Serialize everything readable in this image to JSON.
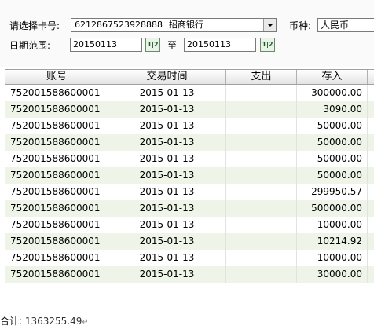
{
  "filters": {
    "card_label": "请选择卡号:",
    "card_number": "6212867523928888",
    "bank_name": "招商银行",
    "currency_label": "币种:",
    "currency_value": "人民币",
    "date_label": "日期范围:",
    "date_from": "20150113",
    "date_to": "20150113",
    "to_label": "至",
    "calendar_button": "1|2"
  },
  "table": {
    "columns": [
      "账号",
      "交易时间",
      "支出",
      "存入"
    ],
    "rows": [
      [
        "752001588600001",
        "2015-01-13",
        "",
        "300000.00"
      ],
      [
        "752001588600001",
        "2015-01-13",
        "",
        "3090.00"
      ],
      [
        "752001588600001",
        "2015-01-13",
        "",
        "50000.00"
      ],
      [
        "752001588600001",
        "2015-01-13",
        "",
        "50000.00"
      ],
      [
        "752001588600001",
        "2015-01-13",
        "",
        "50000.00"
      ],
      [
        "752001588600001",
        "2015-01-13",
        "",
        "50000.00"
      ],
      [
        "752001588600001",
        "2015-01-13",
        "",
        "299950.57"
      ],
      [
        "752001588600001",
        "2015-01-13",
        "",
        "500000.00"
      ],
      [
        "752001588600001",
        "2015-01-13",
        "",
        "10000.00"
      ],
      [
        "752001588600001",
        "2015-01-13",
        "",
        "10214.92"
      ],
      [
        "752001588600001",
        "2015-01-13",
        "",
        "10000.00"
      ],
      [
        "752001588600001",
        "2015-01-13",
        "",
        "30000.00"
      ]
    ]
  },
  "total": {
    "label": "合计:",
    "amount": "1363255.49",
    "mark": "↵"
  },
  "colors": {
    "alt_row": "#eef5e8",
    "header_bg": "#e4e4e4"
  },
  "icons": {
    "dropdown": "chevron-down-icon",
    "calendar": "calendar-icon"
  }
}
